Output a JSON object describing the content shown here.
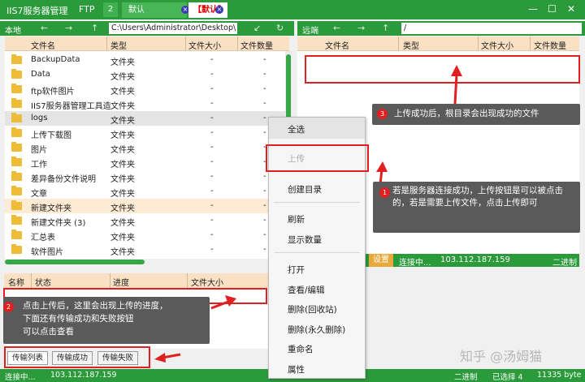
{
  "titlebar": {
    "app_title": "IIS7服务器管理",
    "ftp_label": "FTP",
    "tab_number": "2",
    "tab1": "默认",
    "tab2": "【默认】",
    "close_glyph": "×",
    "minimize": "—",
    "maximize": "☐",
    "close": "✕"
  },
  "local": {
    "label": "本地",
    "path": "C:\\Users\\Administrator\\Desktop\\",
    "columns": [
      "文件名",
      "类型",
      "文件大小",
      "文件数量"
    ],
    "files": [
      {
        "name": "BackupData",
        "type": "文件夹",
        "size": "-",
        "count": "-"
      },
      {
        "name": "Data",
        "type": "文件夹",
        "size": "-",
        "count": "-"
      },
      {
        "name": "ftp软件图片",
        "type": "文件夹",
        "size": "-",
        "count": "-"
      },
      {
        "name": "IIS7服务器管理工具造",
        "type": "文件夹",
        "size": "-",
        "count": "-"
      },
      {
        "name": "logs",
        "type": "文件夹",
        "size": "-",
        "count": "-"
      },
      {
        "name": "上传下载图",
        "type": "文件夹",
        "size": "-",
        "count": "-"
      },
      {
        "name": "图片",
        "type": "文件夹",
        "size": "-",
        "count": "-"
      },
      {
        "name": "工作",
        "type": "文件夹",
        "size": "-",
        "count": "-"
      },
      {
        "name": "差异备份文件说明",
        "type": "文件夹",
        "size": "-",
        "count": "-"
      },
      {
        "name": "文章",
        "type": "文件夹",
        "size": "-",
        "count": "-"
      },
      {
        "name": "新建文件夹",
        "type": "文件夹",
        "size": "-",
        "count": "-"
      },
      {
        "name": "新建文件夹 (3)",
        "type": "文件夹",
        "size": "-",
        "count": "-"
      },
      {
        "name": "汇总表",
        "type": "文件夹",
        "size": "-",
        "count": "-"
      },
      {
        "name": "软件图片",
        "type": "文件夹",
        "size": "-",
        "count": "-"
      }
    ]
  },
  "remote": {
    "label": "远端",
    "path": "/",
    "columns": [
      "文件名",
      "类型",
      "文件大小",
      "文件数量"
    ],
    "settings": "设置",
    "status": "连接中...",
    "ip": "103.112.187.159",
    "mode": "二进制"
  },
  "transfer": {
    "columns": [
      "名称",
      "状态",
      "进度",
      "文件大小"
    ],
    "tabs": [
      "传输列表",
      "传输成功",
      "传输失败"
    ]
  },
  "context_menu": [
    "全选",
    "上传",
    "创建目录",
    "刷新",
    "显示数量",
    "打开",
    "查看/编辑",
    "删除(回收站)",
    "删除(永久删除)",
    "重命名",
    "属性"
  ],
  "statusbar": {
    "status": "连接中...",
    "ip": "103.112.187.159",
    "mode": "二进制",
    "selected": "已选择 4",
    "bytes": "11335 byte"
  },
  "annotations": {
    "badge1": "1",
    "note1": "若是服务器连接成功，上传按钮是可以被点击的，若是需要上传文件，点击上传即可",
    "badge2": "2",
    "note2_line1": "点击上传后，这里会出现上传的进度，",
    "note2_line2": "下面还有传输成功和失败按钮",
    "note2_line3": "可以点击查看",
    "badge3": "3",
    "note3": "上传成功后，根目录会出现成功的文件"
  },
  "watermark": "知乎 @汤姆猫",
  "colors": {
    "theme_green": "#2b9a3a",
    "header_peach": "#fbe1c4",
    "annotation_red": "#e02020",
    "callout_gray": "#5a5a5a"
  },
  "icons": {
    "folder": "folder-icon",
    "nav_back": "arrow-left-icon",
    "nav_forward": "arrow-right-icon",
    "nav_up": "arrow-up-icon",
    "refresh": "refresh-icon"
  }
}
